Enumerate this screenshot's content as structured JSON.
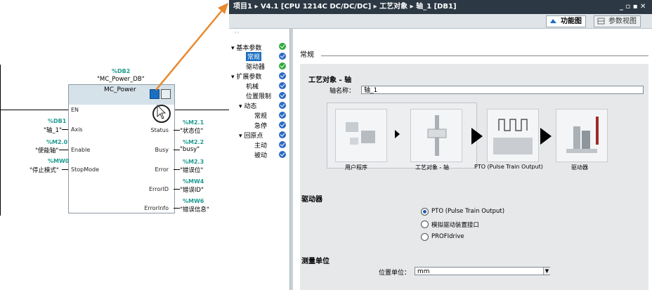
{
  "fb": {
    "db_number": "%DB2",
    "db_name": "\"MC_Power_DB\"",
    "block_name": "MC_Power",
    "en_label": "EN",
    "inputs": [
      {
        "num": "%DB1",
        "name": "\"轴_1\"",
        "pin": "Axis"
      },
      {
        "num": "%M2.0",
        "name": "\"使能轴\"",
        "pin": "Enable"
      },
      {
        "num": "%MW0",
        "name": "\"停止模式\"",
        "pin": "StopMode"
      }
    ],
    "outputs": [
      {
        "pin": "Status",
        "num": "%M2.1",
        "name": "\"状态位\""
      },
      {
        "pin": "Busy",
        "num": "%M2.2",
        "name": "\"busy\""
      },
      {
        "pin": "Error",
        "num": "%M2.3",
        "name": "\"错误位\""
      },
      {
        "pin": "ErrorID",
        "num": "%MW4",
        "name": "\"错误ID\""
      },
      {
        "pin": "ErrorInfo",
        "num": "%MW6",
        "name": "\"错误信息\""
      }
    ]
  },
  "window": {
    "breadcrumb": "项目1 ▸ V4.1 [CPU 1214C DC/DC/DC] ▸ 工艺对象 ▸ 轴_1 [DB1]",
    "controls": "_ ▫ ▪ ✕",
    "tab_function": "功能图",
    "tab_param": "参数视图"
  },
  "nav": {
    "items": [
      {
        "label": "▾ 基本参数",
        "status": "green"
      },
      {
        "label": "常规",
        "status": "blue",
        "selected": true
      },
      {
        "label": "驱动器",
        "status": "green"
      },
      {
        "label": "▾ 扩展参数",
        "status": "blue"
      },
      {
        "label": "机械",
        "status": "blue"
      },
      {
        "label": "位置限制",
        "status": "blue"
      },
      {
        "label": "▾ 动态",
        "status": "blue"
      },
      {
        "label": "常规",
        "status": "blue"
      },
      {
        "label": "急停",
        "status": "blue"
      },
      {
        "label": "▾ 回原点",
        "status": "blue"
      },
      {
        "label": "主动",
        "status": "blue"
      },
      {
        "label": "被动",
        "status": "blue"
      }
    ]
  },
  "content": {
    "section_general": "常规",
    "tech_object_title": "工艺对象 - 轴",
    "axis_name_label": "轴名称：",
    "axis_name_value": "轴_1",
    "diagram_captions": [
      "用户程序",
      "工艺对象 - 轴",
      "PTO (Pulse Train Output)",
      "驱动器"
    ],
    "drive_title": "驱动器",
    "drive_options": [
      {
        "label": "PTO (Pulse Train Output)",
        "selected": true
      },
      {
        "label": "模拟驱动装置接口",
        "selected": false
      },
      {
        "label": "PROFIdrive",
        "selected": false
      }
    ],
    "unit_title": "测量单位",
    "unit_label": "位置单位：",
    "unit_value": "mm"
  },
  "colors": {
    "accent": "#1c6fc0",
    "operand": "#1f9a90",
    "callout": "#e8892c"
  }
}
